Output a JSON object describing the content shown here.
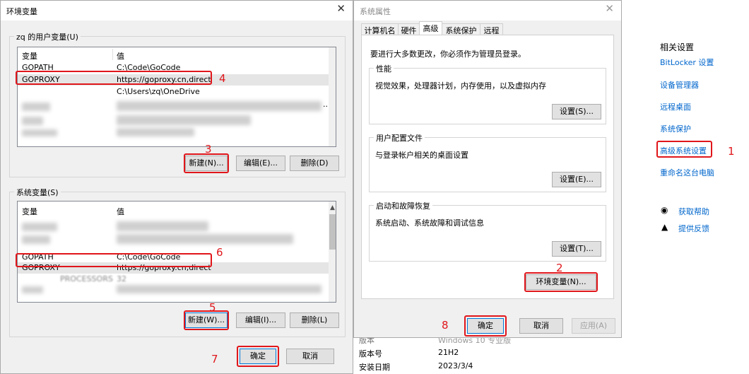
{
  "env_dialog": {
    "title": "环境变量",
    "user_group_label": "zq 的用户变量(U)",
    "user_vars": {
      "header_var": "变量",
      "header_val": "值",
      "rows": [
        {
          "name": "GOPATH",
          "value": "C:\\Code\\GoCode"
        },
        {
          "name": "GOPROXY",
          "value": "https://goproxy.cn,direct"
        },
        {
          "name": "",
          "value": "C:\\Users\\zq\\OneDrive"
        }
      ],
      "ellipsis": "..."
    },
    "user_buttons": {
      "new": "新建(N)...",
      "edit": "编辑(E)...",
      "delete": "删除(D)"
    },
    "sys_group_label": "系统变量(S)",
    "sys_vars": {
      "header_var": "变量",
      "header_val": "值",
      "rows": [
        {
          "name": "GOPATH",
          "value": "C:\\Code\\GoCode"
        },
        {
          "name": "GOPROXY",
          "value": "https://goproxy.cn,direct"
        },
        {
          "name": "PROCESSORS",
          "value": "32"
        }
      ]
    },
    "sys_buttons": {
      "new": "新建(W)...",
      "edit": "编辑(I)...",
      "delete": "删除(L)"
    },
    "ok": "确定",
    "cancel": "取消"
  },
  "sys_props": {
    "title": "系统属性",
    "tabs": [
      "计算机名",
      "硬件",
      "高级",
      "系统保护",
      "远程"
    ],
    "active_tab": "高级",
    "admin_note": "要进行大多数更改，你必须作为管理员登录。",
    "performance": {
      "label": "性能",
      "desc": "视觉效果，处理器计划，内存使用，以及虚拟内存",
      "button": "设置(S)..."
    },
    "profiles": {
      "label": "用户配置文件",
      "desc": "与登录帐户相关的桌面设置",
      "button": "设置(E)..."
    },
    "startup": {
      "label": "启动和故障恢复",
      "desc": "系统启动、系统故障和调试信息",
      "button": "设置(T)..."
    },
    "env_button": "环境变量(N)...",
    "ok": "确定",
    "cancel": "取消",
    "apply": "应用(A)"
  },
  "about": {
    "edition_label": "版本",
    "edition_value": "Windows 10 专业版",
    "version_label": "版本号",
    "version_value": "21H2",
    "install_label": "安装日期",
    "install_value": "2023/3/4"
  },
  "related": {
    "heading": "相关设置",
    "links": [
      "BitLocker 设置",
      "设备管理器",
      "远程桌面",
      "系统保护",
      "高级系统设置",
      "重命名这台电脑"
    ],
    "help": "获取帮助",
    "feedback": "提供反馈"
  },
  "markers": [
    "1",
    "2",
    "3",
    "4",
    "5",
    "6",
    "7",
    "8"
  ],
  "colors": {
    "annotation": "#e0161b",
    "link": "#0066cc",
    "dialog_bg": "#f0f0f0"
  }
}
